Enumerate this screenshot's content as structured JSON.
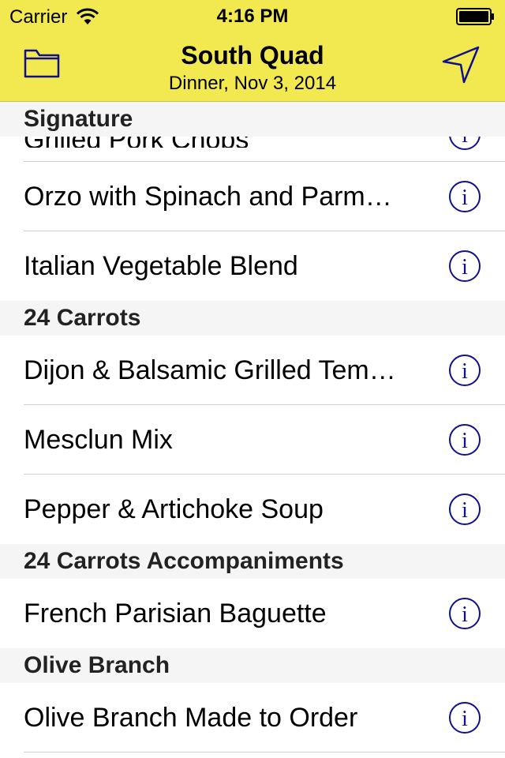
{
  "status_bar": {
    "carrier": "Carrier",
    "time": "4:16 PM",
    "wifi_icon": "wifi-icon",
    "battery_icon": "battery-icon"
  },
  "nav": {
    "title": "South Quad",
    "subtitle": "Dinner, Nov 3, 2014",
    "left_icon": "folder-icon",
    "right_icon": "location-arrow-icon",
    "accent_color": "#f2e950",
    "tint_color": "#10108c"
  },
  "sections": [
    {
      "title": "Signature",
      "partial_item": "Grilled Pork Chops",
      "items": [
        {
          "label": "Orzo with Spinach and Parm…"
        },
        {
          "label": "Italian Vegetable Blend"
        }
      ]
    },
    {
      "title": "24 Carrots",
      "items": [
        {
          "label": "Dijon & Balsamic Grilled Tem…"
        },
        {
          "label": "Mesclun Mix"
        },
        {
          "label": "Pepper & Artichoke Soup"
        }
      ]
    },
    {
      "title": "24 Carrots Accompaniments",
      "items": [
        {
          "label": "French Parisian Baguette"
        }
      ]
    },
    {
      "title": "Olive Branch",
      "items": [
        {
          "label": "Olive Branch Made to Order"
        }
      ]
    }
  ],
  "info_icon": "info-icon"
}
